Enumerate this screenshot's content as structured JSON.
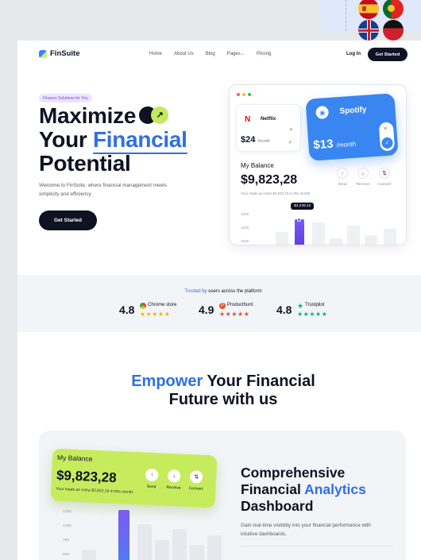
{
  "brand": {
    "name": "FinSuite"
  },
  "nav": {
    "links": [
      "Home",
      "About Us",
      "Blog",
      "Pages",
      "Pricing"
    ],
    "login": "Log In",
    "cta": "Get Started"
  },
  "hero": {
    "pill": "Finance Solutions for You",
    "title_line1": "Maximize",
    "title_line2_a": "Your",
    "title_line2_b": "Financial",
    "title_line3": "Potential",
    "description": "Welcome to FinSuite, where financial management meets simplicity and efficiency.",
    "cta": "Get Started"
  },
  "mock": {
    "netflix": {
      "name": "Netflix",
      "price": "$24",
      "period": "/month"
    },
    "spotify": {
      "name": "Spotify",
      "price": "$13",
      "period": "/month"
    },
    "balance_label": "My Balance",
    "balance_value": "$9,823,28",
    "balance_sub": "Your made an extra $2,832,19 in this month.",
    "actions": [
      "Send",
      "Receive",
      "Convert"
    ],
    "tooltip": "$4,239,12",
    "yticks": [
      "150K",
      "125K",
      "100K"
    ]
  },
  "trusted": {
    "prefix": "Trusted by",
    "suffix": "users across the platform",
    "ratings": [
      {
        "score": "4.8",
        "name": "Chrome store",
        "star_color": "#f5b400",
        "icon_color": "#ea4335"
      },
      {
        "score": "4.9",
        "name": "Producthunt",
        "star_color": "#da552f",
        "icon_color": "#da552f"
      },
      {
        "score": "4.8",
        "name": "Trustpilot",
        "star_color": "#00b67a",
        "icon_color": "#00b67a"
      }
    ]
  },
  "section2": {
    "title_blue": "Empower",
    "title_rest": "Your Financial",
    "title_line2": "Future with us"
  },
  "feature": {
    "card_label": "My Balance",
    "card_value": "$9,823,28",
    "card_sub": "Your made an extra $2,832,19 in this month.",
    "actions": [
      "Send",
      "Receive",
      "Convert"
    ],
    "yticks": [
      "125K",
      "100K",
      "75K",
      "50K"
    ],
    "title_line1": "Comprehensive",
    "title_line2_a": "Financial",
    "title_line2_b": "Analytics",
    "title_line3": "Dashboard",
    "description": "Gain real-time visibility into your financial performance with intuitive dashboards."
  },
  "colors": {
    "accent": "#2f6fe4",
    "dark": "#0f1222",
    "lime": "#c6ec5e",
    "spotify_blue": "#3a86f0"
  }
}
